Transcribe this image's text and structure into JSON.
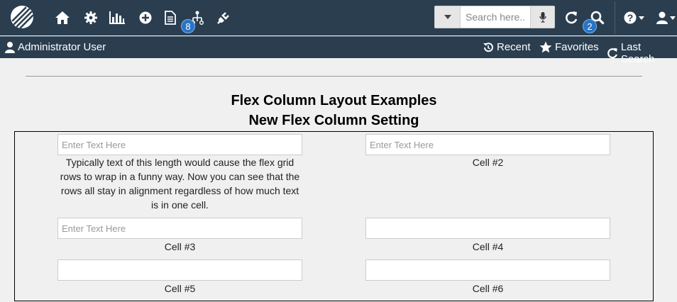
{
  "header": {
    "badge_sitemap": "8",
    "badge_search": "2",
    "search_placeholder": "Search here..."
  },
  "subbar": {
    "user": "Administrator User",
    "recent": "Recent",
    "favorites": "Favorites",
    "last_search": "Last Search"
  },
  "page": {
    "title": "Flex Column Layout Examples",
    "subtitle": "New Flex Column Setting"
  },
  "cells": [
    {
      "placeholder": "Enter Text Here",
      "value": "",
      "label": "Typically text of this length would cause the flex grid rows to wrap in a funny way. Now you can see that the rows all stay in alignment regardless of how much text is in one cell."
    },
    {
      "placeholder": "Enter Text Here",
      "value": "",
      "label": "Cell #2"
    },
    {
      "placeholder": "Enter Text Here",
      "value": "",
      "label": "Cell #3"
    },
    {
      "placeholder": "",
      "value": "",
      "label": "Cell #4"
    },
    {
      "placeholder": "",
      "value": "",
      "label": "Cell #5"
    },
    {
      "placeholder": "",
      "value": "",
      "label": "Cell #6"
    }
  ],
  "colors": {
    "header_bg": "#2b3e50",
    "badge": "#2a74c4",
    "page_bg": "#f0f0f0"
  }
}
